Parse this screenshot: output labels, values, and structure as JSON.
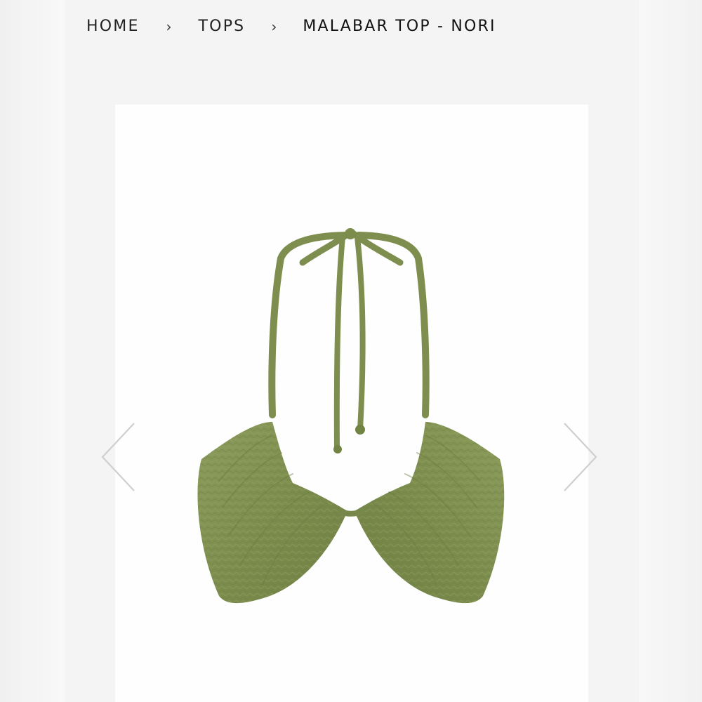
{
  "breadcrumb": {
    "items": [
      {
        "label": "HOME"
      },
      {
        "label": "TOPS"
      },
      {
        "label": "MALABAR TOP - NORI"
      }
    ],
    "separator": "›"
  },
  "gallery": {
    "product_image": "olive-green-halter-bikini-top",
    "previous_icon": "chevron-left-icon",
    "next_icon": "chevron-right-icon"
  },
  "colors": {
    "background": "#f4f4f4",
    "image_background": "#fefefe",
    "text": "#222222",
    "product_green": "#7f9150",
    "arrow": "#cfcfcf"
  }
}
